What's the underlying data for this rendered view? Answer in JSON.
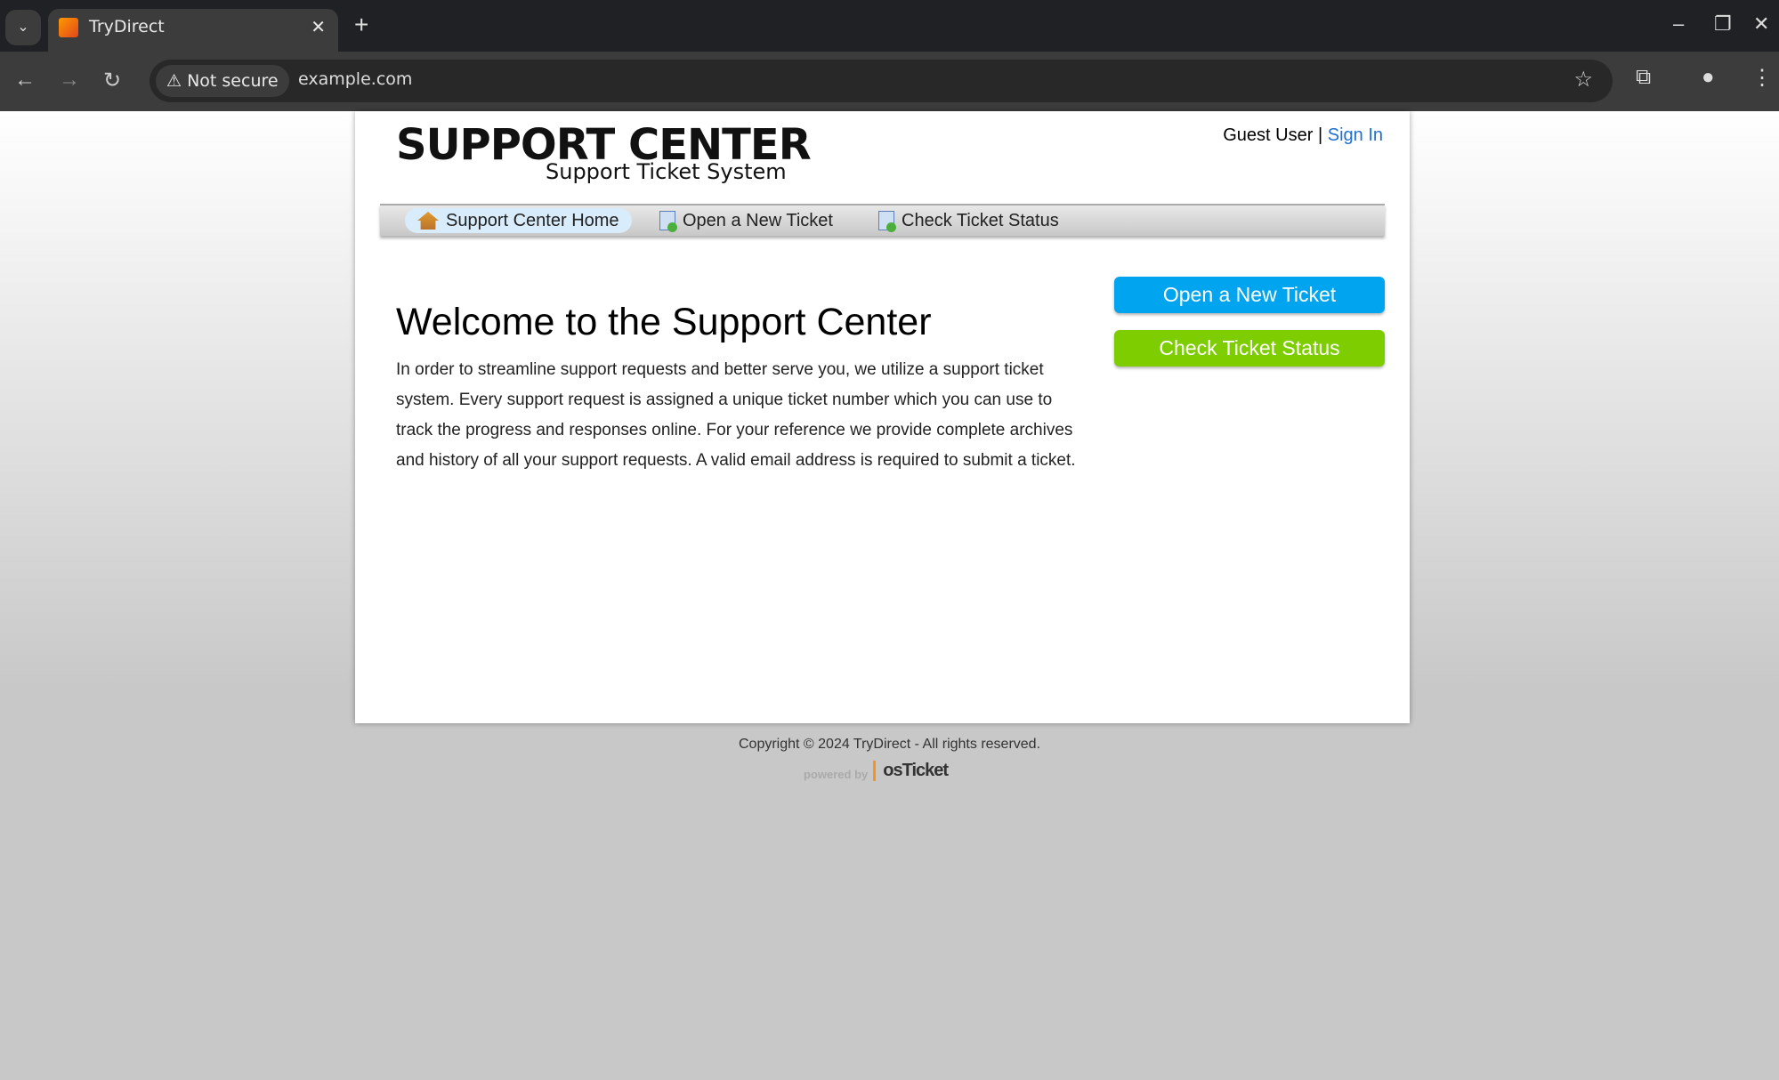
{
  "browser": {
    "tab_title": "TryDirect",
    "security_label": "Not secure",
    "url": "example.com"
  },
  "header": {
    "logo_title": "SUPPORT CENTER",
    "logo_subtitle": "Support Ticket System",
    "guest_label": "Guest User",
    "separator": "|",
    "sign_in": "Sign In"
  },
  "nav": {
    "items": [
      {
        "label": "Support Center Home",
        "icon": "home-icon",
        "active": true
      },
      {
        "label": "Open a New Ticket",
        "icon": "new-ticket-icon"
      },
      {
        "label": "Check Ticket Status",
        "icon": "ticket-status-icon"
      }
    ]
  },
  "main": {
    "title": "Welcome to the Support Center",
    "intro": "In order to streamline support requests and better serve you, we utilize a support ticket system. Every support request is assigned a unique ticket number which you can use to track the progress and responses online. For your reference we provide complete archives and history of all your support requests. A valid email address is required to submit a ticket."
  },
  "sidebar": {
    "open_ticket": "Open a New Ticket",
    "check_status": "Check Ticket Status",
    "open_color": "#00a4ef",
    "check_color": "#7dcd00"
  },
  "footer": {
    "copyright": "Copyright © 2024 TryDirect - All rights reserved.",
    "powered_by": "powered by",
    "brand": "osTicket"
  }
}
